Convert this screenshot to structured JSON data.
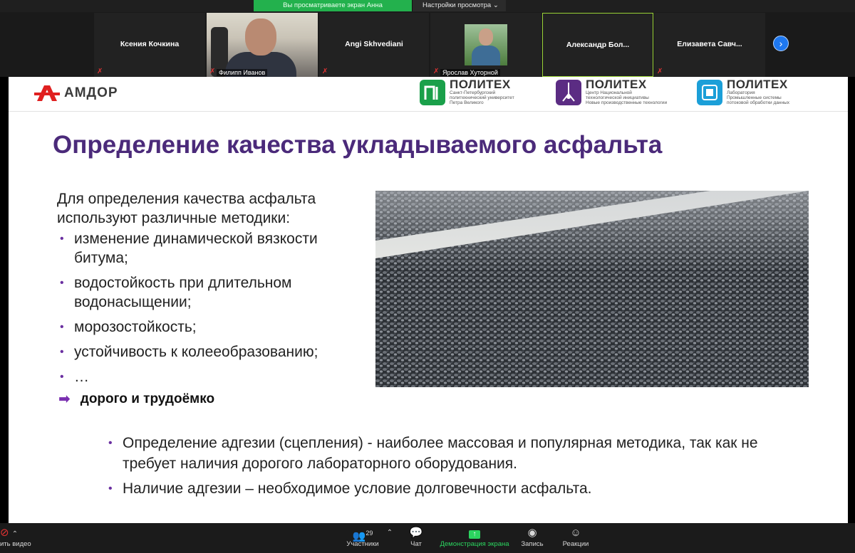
{
  "banner": {
    "viewing": "Вы просматриваете экран Анна Овсянникова",
    "settings": "Настройки просмотра",
    "settings_chevron": "⌄"
  },
  "participants": [
    {
      "name": "Ксения Кочкина"
    },
    {
      "name": "Филипп Иванов"
    },
    {
      "name": "Angi Skhvediani"
    },
    {
      "name": "Ярослав Хуторной"
    },
    {
      "name": "Александр  Бол..."
    },
    {
      "name": "Елизавета  Савч..."
    }
  ],
  "slide": {
    "logo": "АМДОР",
    "partners": [
      {
        "title": "ПОЛИТЕХ",
        "sub": [
          "Санкт-Петербургский",
          "политехнический университет",
          "Петра Великого"
        ]
      },
      {
        "title": "ПОЛИТЕХ",
        "sub": [
          "Центр Национальной",
          "технологической инициативы",
          "Новые производственные технологии"
        ]
      },
      {
        "title": "ПОЛИТЕХ",
        "sub": [
          "Лаборатория",
          "Промышленные системы",
          "потоковой обработки данных"
        ]
      }
    ],
    "title": "Определение качества укладываемого асфальта",
    "intro": "Для определения качества асфальта используют различные методики:",
    "bullets": [
      "изменение динамической вязкости битума;",
      "водостойкость при длительном водонасыщении;",
      "морозостойкость;",
      "устойчивость к колееобразованию;",
      "…"
    ],
    "conclusion": "дорого и трудоёмко",
    "bottom_bullets": [
      "Определение адгезии (сцепления) - наиболее массовая и популярная методика, так как не требует наличия дорогого лабораторного оборудования.",
      "Наличие адгезии – необходимое условие долговечности асфальта."
    ]
  },
  "toolbar": {
    "video": "ить видео",
    "participants": "Участники",
    "participants_count": "29",
    "chat": "Чат",
    "share": "Демонстрация экрана",
    "record": "Запись",
    "reactions": "Реакции"
  },
  "colors": {
    "accent_purple": "#4b2a7a",
    "bullet": "#6a2fa0",
    "share_green": "#2bd45f",
    "amdor_red": "#e02020"
  }
}
